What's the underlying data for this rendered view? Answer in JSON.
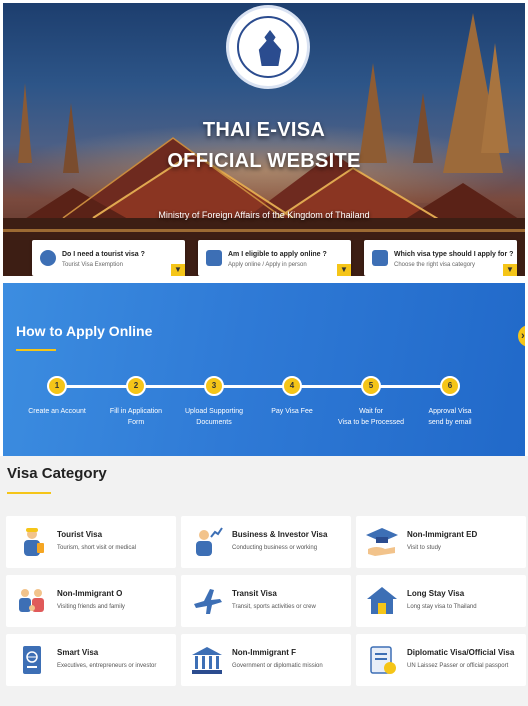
{
  "hero": {
    "title_line1": "THAI E-VISA",
    "title_line2": "OFFICIAL WEBSITE",
    "subtitle": "Ministry of Foreign Affairs of the Kingdom of Thailand",
    "cards": [
      {
        "title": "Do I need a tourist visa ?",
        "subtitle": "Tourist Visa Exemption",
        "icon": "passport-icon",
        "arrow": "chevron-down-icon"
      },
      {
        "title": "Am I eligible to apply online ?",
        "subtitle": "Apply online / Apply in person",
        "icon": "monitor-icon",
        "arrow": "chevron-down-icon"
      },
      {
        "title": "Which visa type should I apply for ?",
        "subtitle": "Choose the right visa category",
        "icon": "document-icon",
        "arrow": "chevron-down-icon"
      }
    ]
  },
  "apply": {
    "title": "How to Apply Online",
    "steps": [
      {
        "number": "1",
        "label_line1": "Create an Account",
        "label_line2": ""
      },
      {
        "number": "2",
        "label_line1": "Fill in Application",
        "label_line2": "Form"
      },
      {
        "number": "3",
        "label_line1": "Upload Supporting",
        "label_line2": "Documents"
      },
      {
        "number": "4",
        "label_line1": "Pay Visa Fee",
        "label_line2": ""
      },
      {
        "number": "5",
        "label_line1": "Wait for",
        "label_line2": "Visa to be Processed"
      },
      {
        "number": "6",
        "label_line1": "Approval Visa",
        "label_line2": "send by email"
      }
    ],
    "next_icon": "chevron-right-icon"
  },
  "visa_category": {
    "title": "Visa Category",
    "items": [
      {
        "name": "Tourist Visa",
        "description": "Tourism, short visit or medical",
        "icon": "tourist-icon"
      },
      {
        "name": "Business & Investor Visa",
        "description": "Conducting business or working",
        "icon": "business-icon"
      },
      {
        "name": "Non-Immigrant ED",
        "description": "Visit to study",
        "icon": "graduation-cap-icon"
      },
      {
        "name": "Non-Immigrant O",
        "description": "Visiting friends and family",
        "icon": "family-icon"
      },
      {
        "name": "Transit Visa",
        "description": "Transit, sports activities or crew",
        "icon": "airplane-icon"
      },
      {
        "name": "Long Stay Visa",
        "description": "Long stay visa to Thailand",
        "icon": "house-icon"
      },
      {
        "name": "Smart Visa",
        "description": "Executives, entrepreneurs or investor",
        "icon": "smart-passport-icon"
      },
      {
        "name": "Non-Immigrant F",
        "description": "Government or diplomatic mission",
        "icon": "government-building-icon"
      },
      {
        "name": "Diplomatic Visa/Official Visa",
        "description": "UN Laissez Passer or official passport",
        "icon": "official-document-icon"
      }
    ]
  },
  "colors": {
    "accent_yellow": "#f5c518",
    "apply_blue": "#2f7ad6",
    "icon_blue": "#3d6fb5",
    "category_bg": "#f2f2f2"
  }
}
